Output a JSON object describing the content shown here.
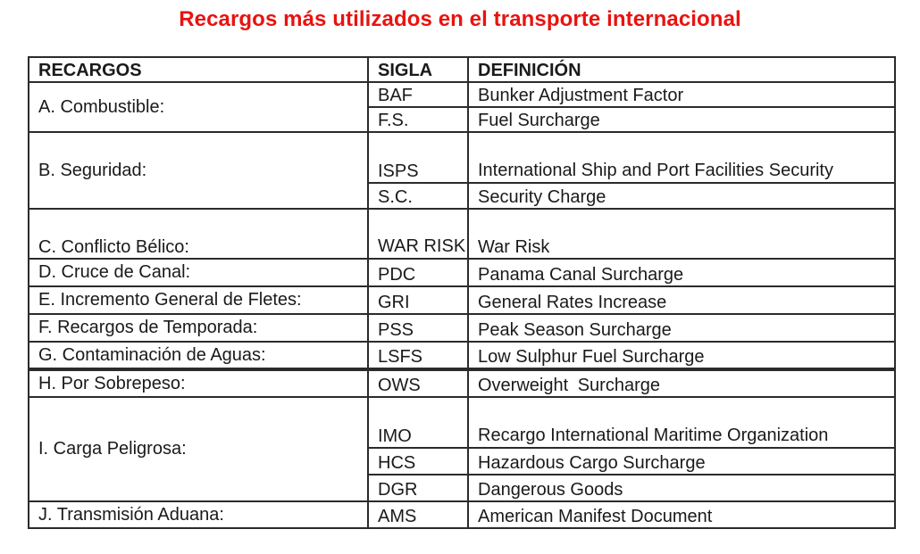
{
  "title": "Recargos más utilizados en el transporte internacional",
  "colors": {
    "title": "#e8130f",
    "border": "#2b2b2b",
    "text": "#1a1a1a"
  },
  "table": {
    "headers": [
      "RECARGOS",
      "SIGLA",
      "DEFINICIÓN"
    ],
    "rows": [
      {
        "category": "A. Combustible:",
        "sigla": "BAF",
        "definition": "Bunker Adjustment Factor"
      },
      {
        "category": "",
        "sigla": "F.S.",
        "definition": "Fuel Surcharge"
      },
      {
        "category": "B. Seguridad:",
        "sigla": "ISPS",
        "definition": "International Ship and Port Facilities Security"
      },
      {
        "category": "",
        "sigla": "S.C.",
        "definition": "Security Charge"
      },
      {
        "category": "C. Conflicto Bélico:",
        "sigla": "WAR RISK",
        "definition": "War Risk"
      },
      {
        "category": "D. Cruce de Canal:",
        "sigla": "PDC",
        "definition": "Panama Canal Surcharge"
      },
      {
        "category": "E. Incremento General de Fletes:",
        "sigla": "GRI",
        "definition": "General Rates Increase"
      },
      {
        "category": "F. Recargos de Temporada:",
        "sigla": "PSS",
        "definition": "Peak Season Surcharge"
      },
      {
        "category": "G. Contaminación de Aguas:",
        "sigla": "LSFS",
        "definition": "Low Sulphur Fuel Surcharge"
      },
      {
        "category": "H. Por Sobrepeso:",
        "sigla": "OWS",
        "definition": "Overweight Surcharge"
      },
      {
        "category": "I. Carga Peligrosa:",
        "sigla": "IMO",
        "definition": "Recargo International Maritime Organization"
      },
      {
        "category": "",
        "sigla": "HCS",
        "definition": "Hazardous Cargo Surcharge"
      },
      {
        "category": "",
        "sigla": "DGR",
        "definition": "Dangerous Goods"
      },
      {
        "category": "J. Transmisión Aduana:",
        "sigla": "AMS",
        "definition": "American Manifest Document"
      }
    ]
  }
}
